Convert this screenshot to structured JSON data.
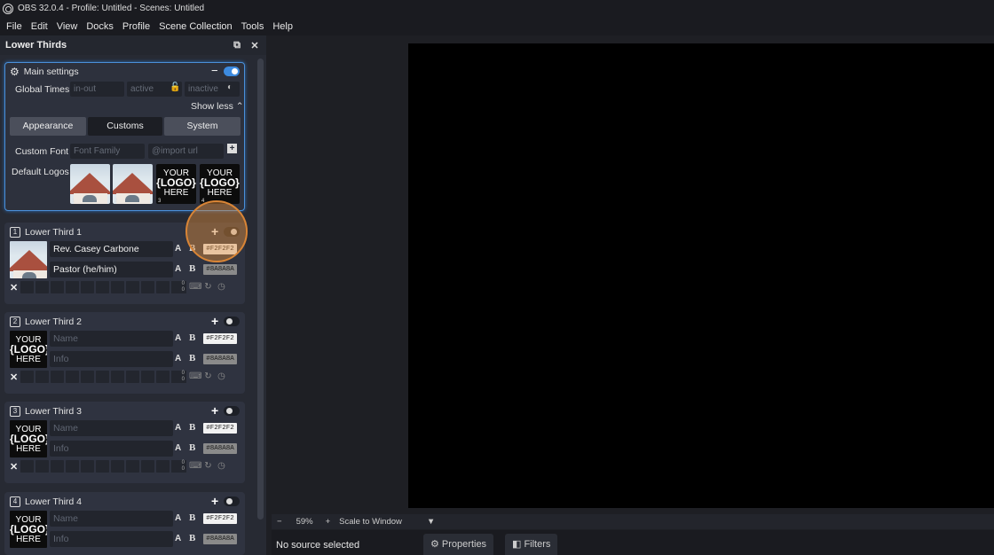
{
  "window": {
    "title": "OBS 32.0.4 - Profile: Untitled - Scenes: Untitled"
  },
  "menu": [
    "File",
    "Edit",
    "View",
    "Docks",
    "Profile",
    "Scene Collection",
    "Tools",
    "Help"
  ],
  "dock": {
    "title": "Lower Thirds",
    "main_settings": {
      "label": "Main settings",
      "minus": "−",
      "enabled": true,
      "global_times_label": "Global Times",
      "in_out_placeholder": "in-out",
      "active_placeholder": "active",
      "inactive_placeholder": "inactive",
      "show_less": "Show less ⌃",
      "tabs": [
        {
          "label": "Appearance",
          "active": false
        },
        {
          "label": "Customs",
          "active": true
        },
        {
          "label": "System",
          "active": false
        }
      ],
      "custom_font_label": "Custom Font",
      "font_family_placeholder": "Font Family",
      "import_url_placeholder": "@import url",
      "default_logos_label": "Default Logos",
      "logos": [
        {
          "num": "1",
          "kind": "church"
        },
        {
          "num": "2",
          "kind": "church"
        },
        {
          "num": "3",
          "kind": "your-logo"
        },
        {
          "num": "4",
          "kind": "your-logo"
        }
      ]
    },
    "your_logo": {
      "line1": "YOUR",
      "line2": "{LOGO}",
      "line3": "HERE"
    },
    "lower_thirds": [
      {
        "num": "1",
        "title": "Lower Third 1",
        "name_value": "Rev. Casey Carbone",
        "info_value": "Pastor (he/him)",
        "name_placeholder": "Name",
        "info_placeholder": "Info",
        "name_color": "#F2F2F2",
        "info_color": "#8A8A8A",
        "thumb": "church",
        "steps": "0\n0"
      },
      {
        "num": "2",
        "title": "Lower Third 2",
        "name_value": "",
        "info_value": "",
        "name_placeholder": "Name",
        "info_placeholder": "Info",
        "name_color": "#F2F2F2",
        "info_color": "#8A8A8A",
        "thumb": "your-logo",
        "steps": "0\n0"
      },
      {
        "num": "3",
        "title": "Lower Third 3",
        "name_value": "",
        "info_value": "",
        "name_placeholder": "Name",
        "info_placeholder": "Info",
        "name_color": "#F2F2F2",
        "info_color": "#8A8A8A",
        "thumb": "your-logo",
        "steps": "0\n0"
      },
      {
        "num": "4",
        "title": "Lower Third 4",
        "name_value": "",
        "info_value": "",
        "name_placeholder": "Name",
        "info_placeholder": "Info",
        "name_color": "#F2F2F2",
        "info_color": "#8A8A8A",
        "thumb": "your-logo",
        "steps": ""
      }
    ]
  },
  "preview": {
    "zoom_minus": "−",
    "zoom_value": "59%",
    "zoom_plus": "+",
    "scale_mode": "Scale to Window",
    "no_source": "No source selected",
    "properties_label": "Properties",
    "filters_label": "Filters"
  },
  "colors": {
    "accent": "#3d8be0",
    "highlight": "#d98536"
  }
}
